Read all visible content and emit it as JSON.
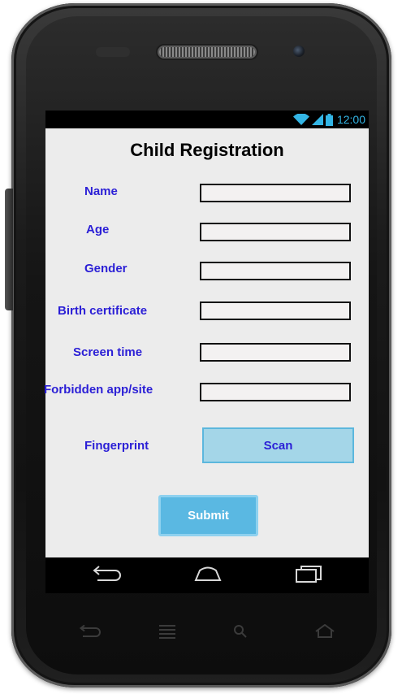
{
  "status_bar": {
    "time": "12:00",
    "icons": [
      "wifi-icon",
      "signal-icon",
      "battery-icon"
    ],
    "icon_color": "#33b5e5"
  },
  "form": {
    "title": "Child Registration",
    "fields": [
      {
        "label": "Name",
        "value": "",
        "placeholder": ""
      },
      {
        "label": "Age",
        "value": "",
        "placeholder": ""
      },
      {
        "label": "Gender",
        "value": "",
        "placeholder": ""
      },
      {
        "label": "Birth certificate",
        "value": "",
        "placeholder": ""
      },
      {
        "label": "Screen time",
        "value": "",
        "placeholder": ""
      },
      {
        "label": "Forbidden app/site",
        "value": "",
        "placeholder": ""
      }
    ],
    "fingerprint_label": "Fingerprint",
    "scan_label": "Scan",
    "submit_label": "Submit"
  },
  "nav_bar": {
    "buttons": [
      "back-icon",
      "home-icon",
      "recent-apps-icon"
    ]
  },
  "hardware_keys": [
    "back-icon",
    "menu-icon",
    "search-icon",
    "home-icon"
  ],
  "colors": {
    "label": "#2b1fd6",
    "scan_bg": "#a4d6e8",
    "submit_bg": "#5ab8e2",
    "screen_bg": "#ececec"
  }
}
